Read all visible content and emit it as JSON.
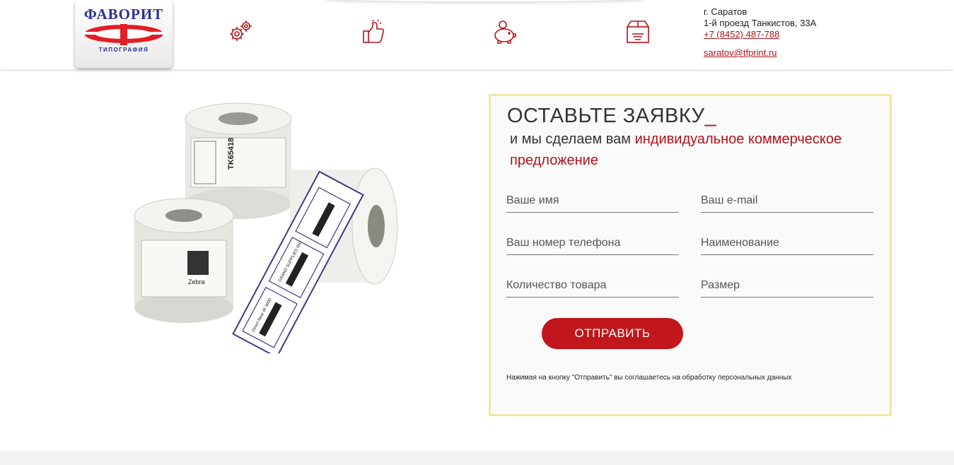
{
  "header": {
    "logo": {
      "title": "ФАВОРИТ",
      "subtitle": "ТИПОГРАФИЯ"
    },
    "feature_icons": [
      "gears-icon",
      "thumbs-up-icon",
      "piggy-bank-icon",
      "delivery-box-icon"
    ],
    "contacts": {
      "city": "г. Саратов",
      "address": "1-й проезд Танкистов, 33А",
      "phone": "+7 (8452) 487-788",
      "email": "saratov@tfprint.ru"
    }
  },
  "product_image": {
    "labels": [
      "TK65418",
      "Zebra",
      "Direct Near IR 3000",
      "GRAND SUPPLIES INC"
    ]
  },
  "form": {
    "title": "ОСТАВЬТЕ ЗАЯВКУ",
    "title_cursor": "_",
    "subtitle_plain": "и мы сделаем вам ",
    "subtitle_highlight": "индивидуальное коммерческое предложение",
    "fields": {
      "name": "Ваше имя",
      "email": "Ваш e-mail",
      "phone": "Ваш номер телефона",
      "product": "Наименование",
      "quantity": "Количество товара",
      "size": "Размер"
    },
    "submit_label": "ОТПРАВИТЬ",
    "consent": "Нажимая на кнопку \"Отправить\" вы соглашаетесь на обработку персональных данных"
  },
  "colors": {
    "accent": "#c0161c",
    "brand_blue": "#2e3192",
    "form_border": "#f4e6a4"
  }
}
